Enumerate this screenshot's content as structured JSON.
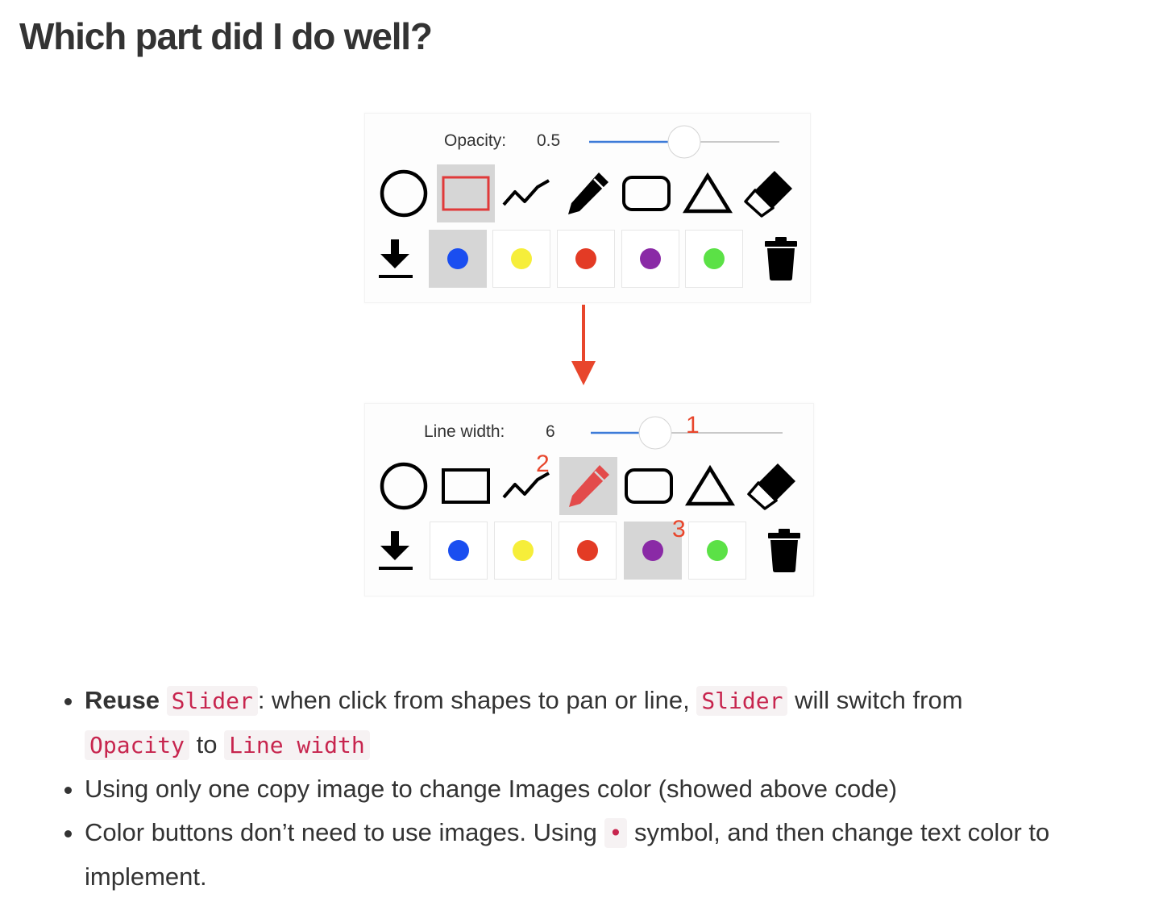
{
  "heading": "Which part did I do well?",
  "panel_top": {
    "slider_label": "Opacity:",
    "slider_value": "0.5",
    "slider_fraction": 0.5,
    "selected_tool": "rectangle",
    "selected_color": "blue"
  },
  "panel_bottom": {
    "slider_label": "Line width:",
    "slider_value": "6",
    "slider_fraction": 0.33,
    "selected_tool": "pen",
    "selected_color": "purple",
    "annotations": [
      "1",
      "2",
      "3"
    ]
  },
  "tools": [
    "circle",
    "rectangle",
    "line",
    "pen",
    "rounded-rectangle",
    "triangle",
    "eraser"
  ],
  "colors": {
    "blue": "#1a4ef0",
    "yellow": "#f6ee3a",
    "red": "#e33b25",
    "purple": "#8a2aa6",
    "green": "#5be146",
    "accent": "#e8462c",
    "slider_track": "#3d7bd8",
    "code_text": "#c7254e"
  },
  "bullets": [
    {
      "lead": "Reuse",
      "code1": "Slider",
      "text1": ": when click from shapes to pan or line,",
      "code2": "Slider",
      "text2": "will switch from",
      "code3": "Opacity",
      "text3": "to",
      "code4": "Line width"
    },
    {
      "text": "Using only one copy image to change Images color (showed above code)"
    },
    {
      "text1": "Color buttons don’t need to use images. Using",
      "code": "•",
      "text2": "symbol, and then change text color to implement."
    }
  ]
}
